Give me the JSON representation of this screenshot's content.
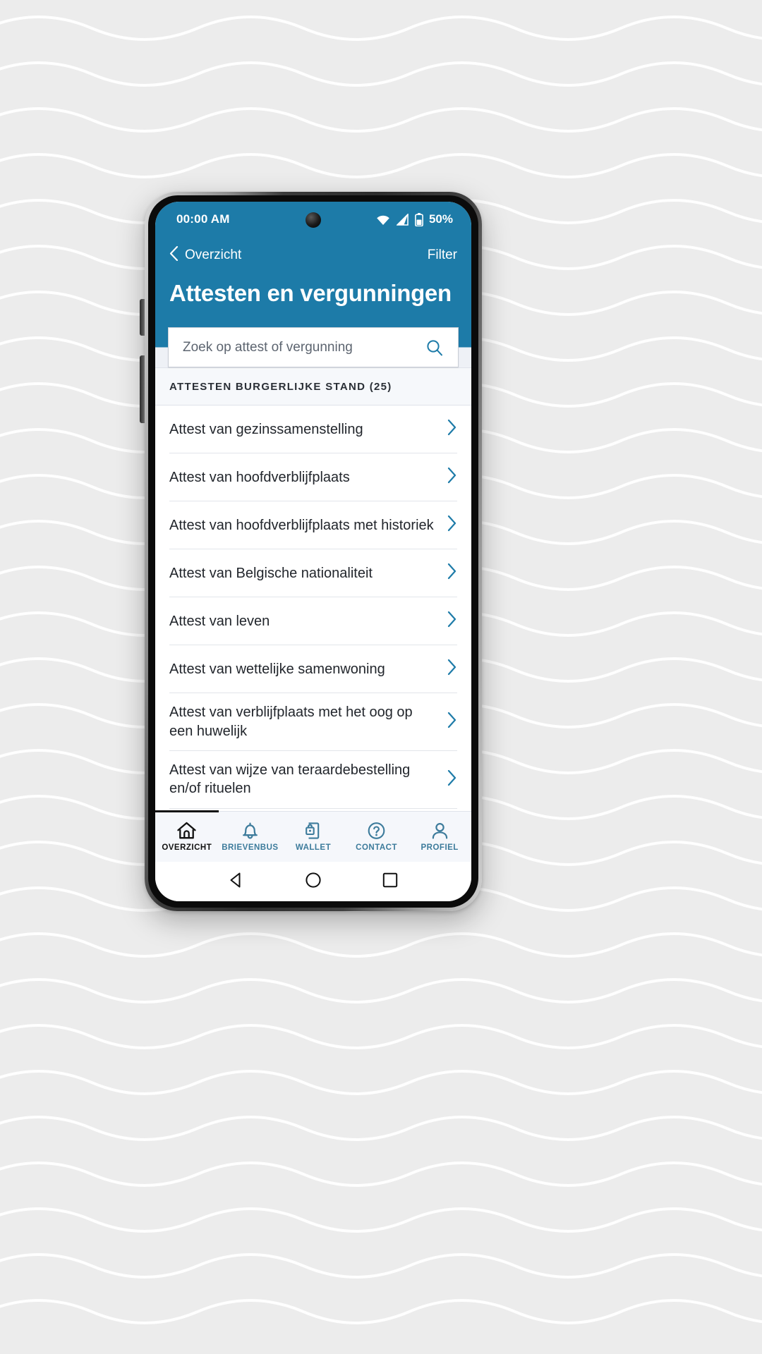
{
  "theme": {
    "brand_blue": "#1d7ba8",
    "tab_blue": "#3c7b9b",
    "active_dark": "#111111",
    "page_bg": "#ececec"
  },
  "statusbar": {
    "time": "00:00 AM",
    "battery_percent": "50%",
    "icons": [
      "wifi-icon",
      "cellular-signal-icon",
      "battery-icon"
    ]
  },
  "header": {
    "back_label": "Overzicht",
    "back_icon": "chevron-left-icon",
    "filter_label": "Filter",
    "title": "Attesten en vergunningen"
  },
  "search": {
    "placeholder": "Zoek op attest of vergunning",
    "value": "",
    "icon": "search-icon"
  },
  "section": {
    "title": "ATTESTEN BURGERLIJKE STAND (25)",
    "count": 25
  },
  "list": {
    "items": [
      {
        "label": "Attest van gezinssamenstelling"
      },
      {
        "label": "Attest van hoofdverblijfplaats"
      },
      {
        "label": "Attest van hoofdverblijfplaats met historiek"
      },
      {
        "label": "Attest van Belgische nationaliteit"
      },
      {
        "label": "Attest van leven"
      },
      {
        "label": "Attest van wettelijke samenwoning"
      },
      {
        "label": "Attest van verblijfplaats met het oog op een huwelijk"
      },
      {
        "label": "Attest van wijze van teraardebestelling en/of rituelen"
      }
    ],
    "chevron_icon": "chevron-right-icon"
  },
  "tabbar": {
    "tabs": [
      {
        "label": "OVERZICHT",
        "icon": "home-icon",
        "active": true
      },
      {
        "label": "BRIEVENBUS",
        "icon": "bell-icon",
        "active": false
      },
      {
        "label": "WALLET",
        "icon": "wallet-lock-icon",
        "active": false
      },
      {
        "label": "CONTACT",
        "icon": "question-circle-icon",
        "active": false
      },
      {
        "label": "PROFIEL",
        "icon": "person-icon",
        "active": false
      }
    ]
  },
  "sysnav": {
    "buttons": [
      {
        "icon": "android-back-triangle-icon"
      },
      {
        "icon": "android-home-circle-icon"
      },
      {
        "icon": "android-recents-square-icon"
      }
    ]
  }
}
